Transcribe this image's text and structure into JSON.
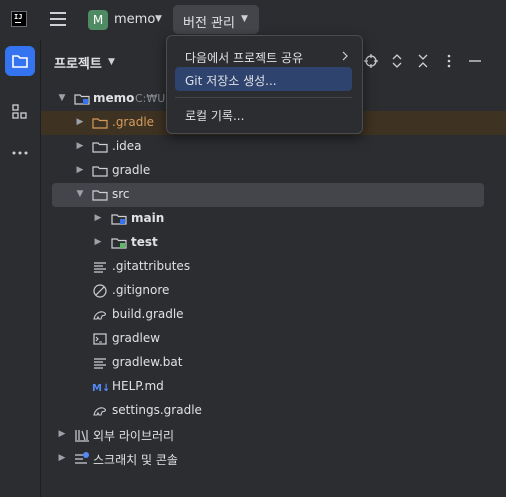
{
  "topbar": {
    "logo_text": "IJ",
    "project_badge": "M",
    "project_name": "memo",
    "vcs_menu_label": "버전 관리",
    "colors": {
      "badge": "#4e8b62",
      "active": "#3574f0"
    }
  },
  "sidebar": {
    "items": [
      {
        "icon": "folder-icon",
        "active": true
      },
      {
        "icon": "structure-icon",
        "active": false
      },
      {
        "icon": "more-icon",
        "active": false
      }
    ]
  },
  "project_panel": {
    "title": "프로젝트",
    "toolbar_icons": [
      "locate-icon",
      "expand-icon",
      "collapse-icon",
      "options-icon",
      "hide-icon"
    ]
  },
  "tree": {
    "root_name": "memo",
    "root_path_hint": "C:₩Us",
    "items": [
      {
        "label": ".gradle",
        "icon": "folder-icon"
      },
      {
        "label": ".idea",
        "icon": "folder-icon"
      },
      {
        "label": "gradle",
        "icon": "folder-icon"
      },
      {
        "label": "src",
        "icon": "folder-icon"
      },
      {
        "label": "main",
        "icon": "module-folder-icon"
      },
      {
        "label": "test",
        "icon": "module-folder-icon"
      },
      {
        "label": ".gitattributes",
        "icon": "text-file-icon"
      },
      {
        "label": ".gitignore",
        "icon": "ignore-file-icon"
      },
      {
        "label": "build.gradle",
        "icon": "gradle-file-icon"
      },
      {
        "label": "gradlew",
        "icon": "terminal-file-icon"
      },
      {
        "label": "gradlew.bat",
        "icon": "text-file-icon"
      },
      {
        "label": "HELP.md",
        "icon": "markdown-file-icon"
      },
      {
        "label": "settings.gradle",
        "icon": "gradle-file-icon"
      },
      {
        "label": "외부 라이브러리",
        "icon": "library-icon"
      },
      {
        "label": "스크래치 및 콘솔",
        "icon": "scratch-icon"
      }
    ]
  },
  "vcs_dropdown": {
    "items": [
      {
        "label": "다음에서 프로젝트 공유",
        "has_submenu": true
      },
      {
        "label": "Git 저장소 생성...",
        "selected": true
      },
      {
        "label": "로컬 기록..."
      }
    ]
  }
}
